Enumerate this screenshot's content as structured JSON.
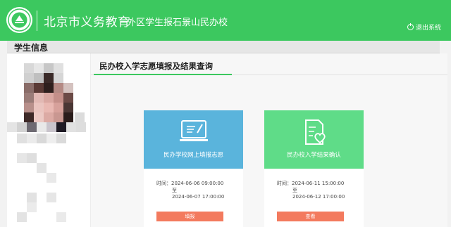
{
  "header": {
    "title": "北京市义务教育",
    "subtitle": "外区学生报石景山民办校",
    "logout_label": "退出系统"
  },
  "panel": {
    "title": "学生信息",
    "section_title": "民办校入学志愿填报及结果查询"
  },
  "cards": [
    {
      "label": "民办学校网上填报志愿",
      "time_label": "时间：",
      "start": "2024-06-06 09:00:00",
      "separator": "至",
      "end": "2024-06-07 17:00:00",
      "button": "填报",
      "color": "#5ab4dc"
    },
    {
      "label": "民办校入学结果确认",
      "time_label": "时间：",
      "start": "2024-06-11 15:00:00",
      "separator": "至",
      "end": "2024-06-12 17:00:00",
      "button": "查看",
      "color": "#5fdc88"
    }
  ],
  "colors": {
    "brand": "#3cc85f",
    "button": "#f37a5e"
  }
}
